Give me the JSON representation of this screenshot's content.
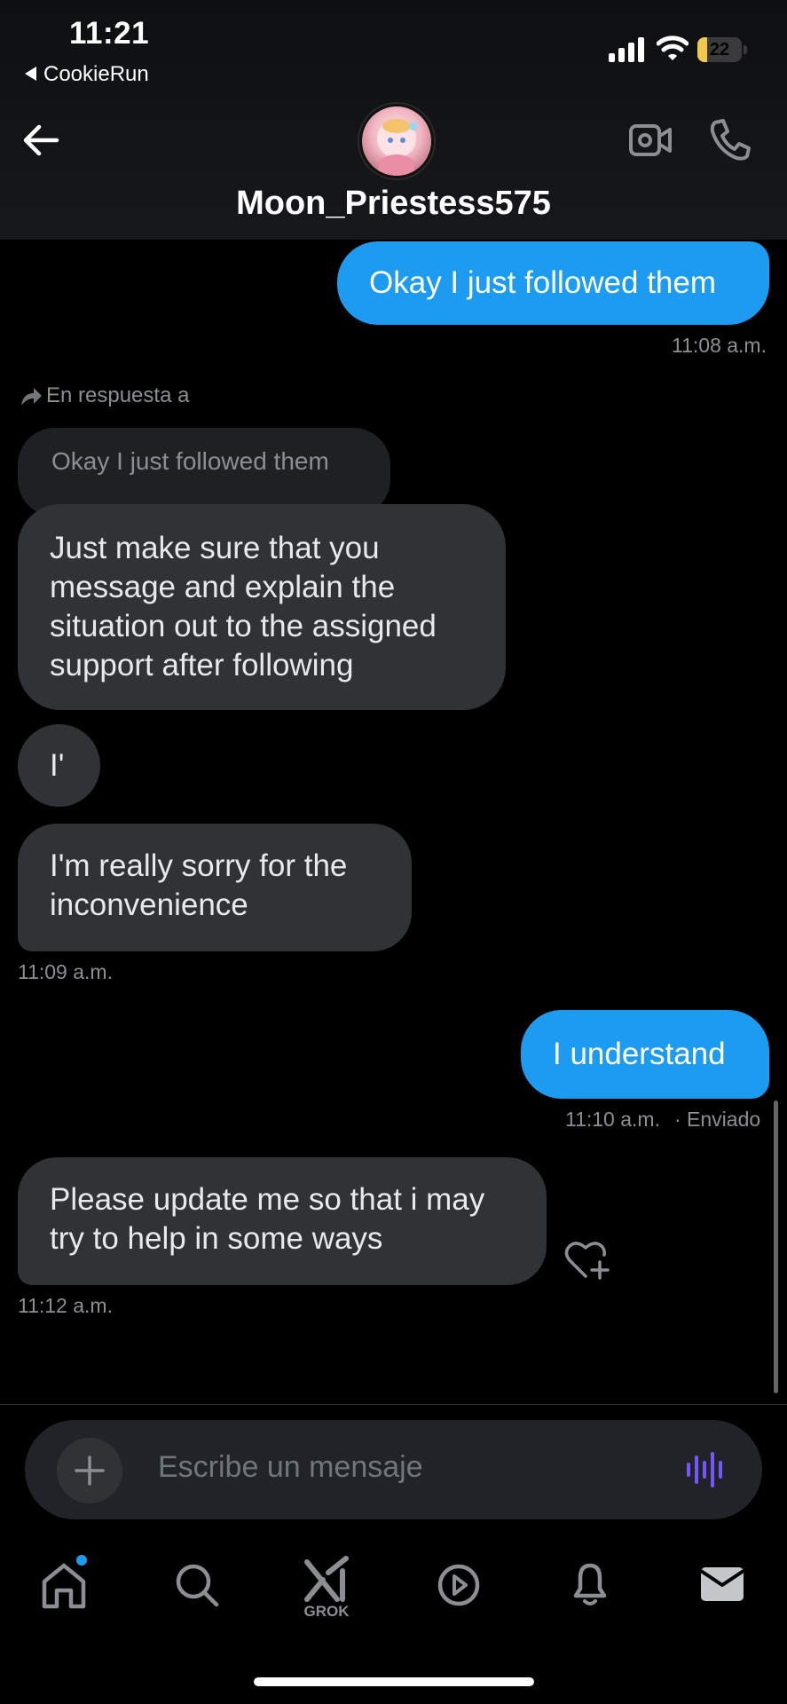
{
  "status_bar": {
    "time": "11:21",
    "back_app": "CookieRun",
    "battery": "22",
    "battery_level": 0.22
  },
  "header": {
    "contact_name": "Moon_Priestess575"
  },
  "messages": [
    {
      "id": "m1",
      "direction": "out",
      "text": "Okay I just followed them",
      "time": "11:08 a.m."
    },
    {
      "id": "m2",
      "direction": "in",
      "reply_label": "En respuesta a",
      "reply_quote": "Okay I just followed them",
      "text_lines": [
        "Just make sure that you",
        "message and explain the",
        "situation out to the assigned",
        "support after following"
      ]
    },
    {
      "id": "m3",
      "direction": "in",
      "text": "I'"
    },
    {
      "id": "m4",
      "direction": "in",
      "text_lines": [
        "I'm really sorry for the",
        "inconvenience"
      ],
      "time": "11:09 a.m."
    },
    {
      "id": "m5",
      "direction": "out",
      "text": "I understand",
      "time": "11:10 a.m.",
      "status": "· Enviado"
    },
    {
      "id": "m6",
      "direction": "in",
      "text_lines": [
        "Please update me so that i may",
        "try to help in some ways"
      ],
      "time": "11:12 a.m."
    }
  ],
  "composer": {
    "placeholder": "Escribe un mensaje"
  },
  "bottom_nav": {
    "items": [
      "home-icon",
      "search-icon",
      "grok-icon",
      "video-play-icon",
      "bell-icon",
      "mail-icon"
    ],
    "grok_label": "GROK"
  },
  "colors": {
    "outgoing_bubble": "#1d9bf0",
    "incoming_bubble": "#2f3336",
    "accent_voice": "#7856ff"
  }
}
